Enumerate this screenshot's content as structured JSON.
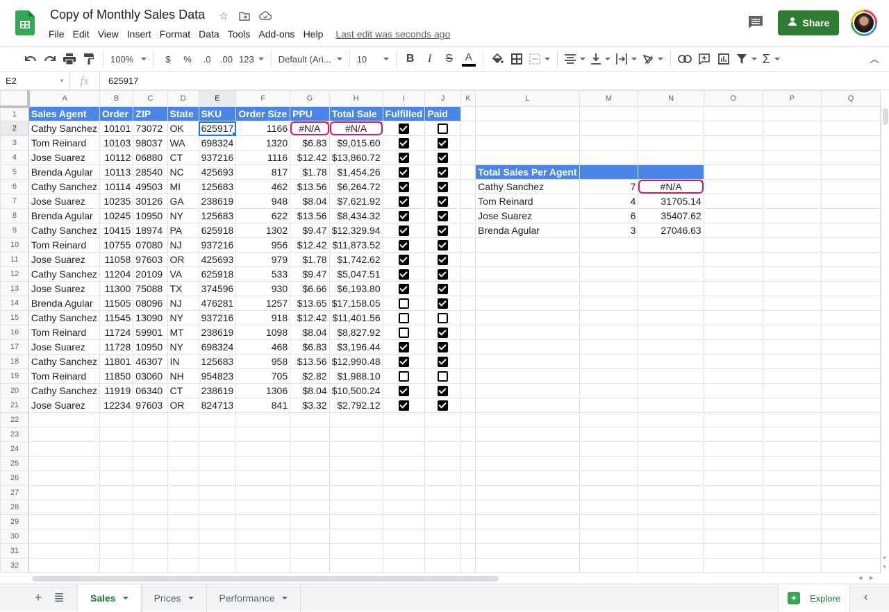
{
  "app": {
    "title": "Copy of Monthly Sales Data",
    "menu": [
      "File",
      "Edit",
      "View",
      "Insert",
      "Format",
      "Data",
      "Tools",
      "Add-ons",
      "Help"
    ],
    "last_edit": "Last edit was seconds ago",
    "share_label": "Share"
  },
  "toolbar": {
    "zoom": "100%",
    "currency": "$",
    "percent": "%",
    "dec_decrease": ".0",
    "dec_increase": ".00",
    "more_formats": "123",
    "font": "Default (Ari...",
    "font_size": "10",
    "bold": "B",
    "italic": "I",
    "strike": "S",
    "text_color_label": "A",
    "text_color": "#000000"
  },
  "formula_bar": {
    "cell_ref": "E2",
    "fx": "fx",
    "value": "625917"
  },
  "grid": {
    "columns": [
      "A",
      "B",
      "C",
      "D",
      "E",
      "F",
      "G",
      "H",
      "I",
      "J",
      "K",
      "L",
      "M",
      "N",
      "O",
      "P",
      "Q"
    ],
    "selected_column": "E",
    "selected_row": 2,
    "header_row": [
      "Sales Agent",
      "Order",
      "ZIP",
      "State",
      "SKU",
      "Order Size",
      "PPU",
      "Total Sale",
      "Fulfilled",
      "Paid"
    ],
    "rows": [
      {
        "agent": "Cathy Sanchez",
        "order": "10101",
        "zip": "73072",
        "state": "OK",
        "sku": "625917",
        "size": "1166",
        "ppu": "#N/A",
        "total": "#N/A",
        "fulfilled": true,
        "paid": false
      },
      {
        "agent": "Tom Reinard",
        "order": "10103",
        "zip": "98037",
        "state": "WA",
        "sku": "698324",
        "size": "1320",
        "ppu": "$6.83",
        "total": "$9,015.60",
        "fulfilled": true,
        "paid": true
      },
      {
        "agent": "Jose Suarez",
        "order": "10112",
        "zip": "06880",
        "state": "CT",
        "sku": "937216",
        "size": "1116",
        "ppu": "$12.42",
        "total": "$13,860.72",
        "fulfilled": true,
        "paid": true
      },
      {
        "agent": "Brenda Agular",
        "order": "10113",
        "zip": "28540",
        "state": "NC",
        "sku": "425693",
        "size": "817",
        "ppu": "$1.78",
        "total": "$1,454.26",
        "fulfilled": true,
        "paid": true
      },
      {
        "agent": "Cathy Sanchez",
        "order": "10114",
        "zip": "49503",
        "state": "MI",
        "sku": "125683",
        "size": "462",
        "ppu": "$13.56",
        "total": "$6,264.72",
        "fulfilled": true,
        "paid": true
      },
      {
        "agent": "Jose Suarez",
        "order": "10235",
        "zip": "30126",
        "state": "GA",
        "sku": "238619",
        "size": "948",
        "ppu": "$8.04",
        "total": "$7,621.92",
        "fulfilled": true,
        "paid": true
      },
      {
        "agent": "Brenda Agular",
        "order": "10245",
        "zip": "10950",
        "state": "NY",
        "sku": "125683",
        "size": "622",
        "ppu": "$13.56",
        "total": "$8,434.32",
        "fulfilled": true,
        "paid": true
      },
      {
        "agent": "Cathy Sanchez",
        "order": "10415",
        "zip": "18974",
        "state": "PA",
        "sku": "625918",
        "size": "1302",
        "ppu": "$9.47",
        "total": "$12,329.94",
        "fulfilled": true,
        "paid": true
      },
      {
        "agent": "Tom Reinard",
        "order": "10755",
        "zip": "07080",
        "state": "NJ",
        "sku": "937216",
        "size": "956",
        "ppu": "$12.42",
        "total": "$11,873.52",
        "fulfilled": true,
        "paid": true
      },
      {
        "agent": "Jose Suarez",
        "order": "11058",
        "zip": "97603",
        "state": "OR",
        "sku": "425693",
        "size": "979",
        "ppu": "$1.78",
        "total": "$1,742.62",
        "fulfilled": true,
        "paid": true
      },
      {
        "agent": "Cathy Sanchez",
        "order": "11204",
        "zip": "20109",
        "state": "VA",
        "sku": "625918",
        "size": "533",
        "ppu": "$9.47",
        "total": "$5,047.51",
        "fulfilled": true,
        "paid": true
      },
      {
        "agent": "Jose Suarez",
        "order": "11300",
        "zip": "75088",
        "state": "TX",
        "sku": "374596",
        "size": "930",
        "ppu": "$6.66",
        "total": "$6,193.80",
        "fulfilled": true,
        "paid": true
      },
      {
        "agent": "Brenda Agular",
        "order": "11505",
        "zip": "08096",
        "state": "NJ",
        "sku": "476281",
        "size": "1257",
        "ppu": "$13.65",
        "total": "$17,158.05",
        "fulfilled": false,
        "paid": true
      },
      {
        "agent": "Cathy Sanchez",
        "order": "11545",
        "zip": "13090",
        "state": "NY",
        "sku": "937216",
        "size": "918",
        "ppu": "$12.42",
        "total": "$11,401.56",
        "fulfilled": false,
        "paid": false
      },
      {
        "agent": "Tom Reinard",
        "order": "11724",
        "zip": "59901",
        "state": "MT",
        "sku": "238619",
        "size": "1098",
        "ppu": "$8.04",
        "total": "$8,827.92",
        "fulfilled": false,
        "paid": true
      },
      {
        "agent": "Jose Suarez",
        "order": "11728",
        "zip": "10950",
        "state": "NY",
        "sku": "698324",
        "size": "468",
        "ppu": "$6.83",
        "total": "$3,196.44",
        "fulfilled": true,
        "paid": true
      },
      {
        "agent": "Cathy Sanchez",
        "order": "11801",
        "zip": "46307",
        "state": "IN",
        "sku": "125683",
        "size": "958",
        "ppu": "$13.56",
        "total": "$12,990.48",
        "fulfilled": true,
        "paid": true
      },
      {
        "agent": "Tom Reinard",
        "order": "11850",
        "zip": "03060",
        "state": "NH",
        "sku": "954823",
        "size": "705",
        "ppu": "$2.82",
        "total": "$1,988.10",
        "fulfilled": false,
        "paid": false
      },
      {
        "agent": "Cathy Sanchez",
        "order": "11919",
        "zip": "06340",
        "state": "CT",
        "sku": "238619",
        "size": "1306",
        "ppu": "$8.04",
        "total": "$10,500.24",
        "fulfilled": true,
        "paid": true
      },
      {
        "agent": "Jose Suarez",
        "order": "12234",
        "zip": "97603",
        "state": "OR",
        "sku": "824713",
        "size": "841",
        "ppu": "$3.32",
        "total": "$2,792.12",
        "fulfilled": true,
        "paid": true
      }
    ],
    "visible_row_count": 32,
    "summary": {
      "title": "Total Sales Per Agent",
      "rows": [
        {
          "agent": "Cathy Sanchez",
          "count": "7",
          "total": "#N/A"
        },
        {
          "agent": "Tom Reinard",
          "count": "4",
          "total": "31705.14"
        },
        {
          "agent": "Jose Suarez",
          "count": "6",
          "total": "35407.62"
        },
        {
          "agent": "Brenda Agular",
          "count": "3",
          "total": "27046.63"
        }
      ]
    }
  },
  "sheets": {
    "tabs": [
      {
        "label": "Sales",
        "active": true
      },
      {
        "label": "Prices",
        "active": false
      },
      {
        "label": "Performance",
        "active": false
      }
    ],
    "explore_label": "Explore"
  },
  "colors": {
    "header_fill": "#4a86e8",
    "error_ring": "#d81b60",
    "share_green": "#2e7d32",
    "active_tab": "#188038",
    "selection": "#1a73e8"
  }
}
